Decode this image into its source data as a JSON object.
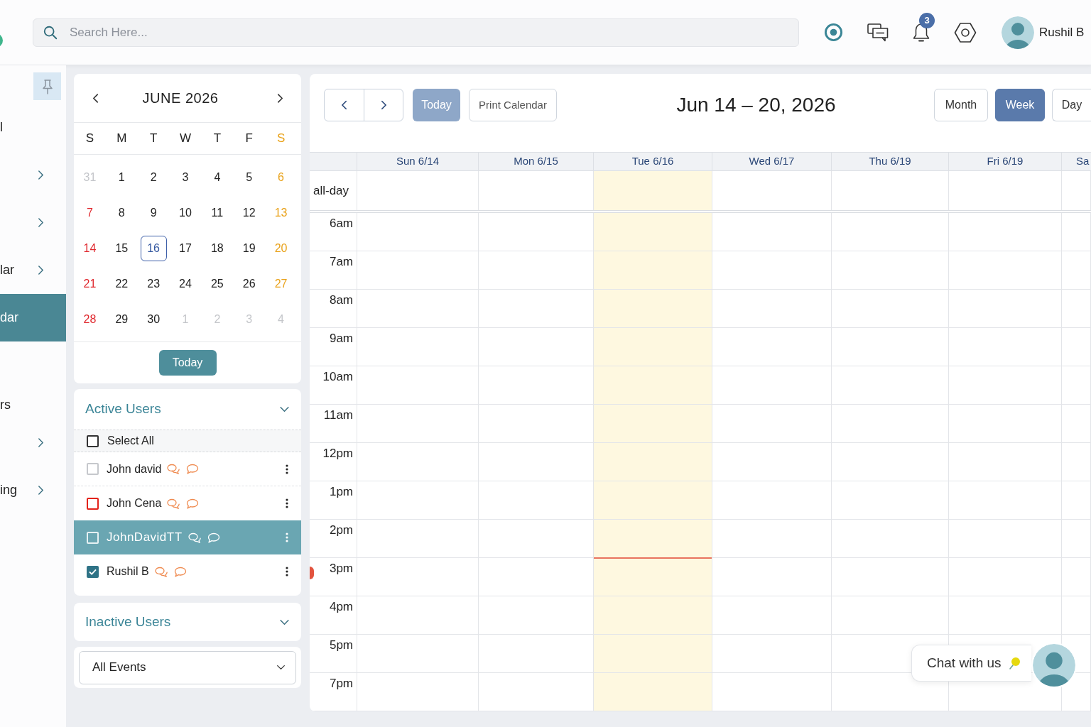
{
  "search": {
    "placeholder": "Search Here..."
  },
  "top_bar": {
    "notification_count": "3",
    "user_name": "Rushil B"
  },
  "sidebar": {
    "items": [
      {
        "kind": "link",
        "label": "l",
        "expandable": false,
        "selected": false
      },
      {
        "kind": "link",
        "expandable": true,
        "selected": false
      },
      {
        "kind": "link",
        "expandable": true,
        "selected": false
      },
      {
        "kind": "link",
        "label": "lar",
        "expandable": true,
        "selected": false
      },
      {
        "kind": "link",
        "label": "dar",
        "expandable": false,
        "selected": true
      },
      {
        "kind": "heading",
        "label": "rs"
      },
      {
        "kind": "link",
        "expandable": true,
        "selected": false
      },
      {
        "kind": "link",
        "label": "ing",
        "expandable": true,
        "selected": false
      }
    ]
  },
  "mini_calendar": {
    "title": "JUNE 2026",
    "weekdays": [
      "S",
      "M",
      "T",
      "W",
      "T",
      "F",
      "S"
    ],
    "weeks": [
      [
        {
          "day": "31",
          "muted": true,
          "selected": false
        },
        {
          "day": "1",
          "muted": false,
          "selected": false
        },
        {
          "day": "2",
          "muted": false,
          "selected": false
        },
        {
          "day": "3",
          "muted": false,
          "selected": false
        },
        {
          "day": "4",
          "muted": false,
          "selected": false
        },
        {
          "day": "5",
          "muted": false,
          "selected": false
        },
        {
          "day": "6",
          "muted": false,
          "selected": false
        }
      ],
      [
        {
          "day": "7",
          "muted": false,
          "selected": false
        },
        {
          "day": "8",
          "muted": false,
          "selected": false
        },
        {
          "day": "9",
          "muted": false,
          "selected": false
        },
        {
          "day": "10",
          "muted": false,
          "selected": false
        },
        {
          "day": "11",
          "muted": false,
          "selected": false
        },
        {
          "day": "12",
          "muted": false,
          "selected": false
        },
        {
          "day": "13",
          "muted": false,
          "selected": false
        }
      ],
      [
        {
          "day": "14",
          "muted": false,
          "selected": false
        },
        {
          "day": "15",
          "muted": false,
          "selected": false
        },
        {
          "day": "16",
          "muted": false,
          "selected": true
        },
        {
          "day": "17",
          "muted": false,
          "selected": false
        },
        {
          "day": "18",
          "muted": false,
          "selected": false
        },
        {
          "day": "19",
          "muted": false,
          "selected": false
        },
        {
          "day": "20",
          "muted": false,
          "selected": false
        }
      ],
      [
        {
          "day": "21",
          "muted": false,
          "selected": false
        },
        {
          "day": "22",
          "muted": false,
          "selected": false
        },
        {
          "day": "23",
          "muted": false,
          "selected": false
        },
        {
          "day": "24",
          "muted": false,
          "selected": false
        },
        {
          "day": "25",
          "muted": false,
          "selected": false
        },
        {
          "day": "26",
          "muted": false,
          "selected": false
        },
        {
          "day": "27",
          "muted": false,
          "selected": false
        }
      ],
      [
        {
          "day": "28",
          "muted": false,
          "selected": false
        },
        {
          "day": "29",
          "muted": false,
          "selected": false
        },
        {
          "day": "30",
          "muted": false,
          "selected": false
        },
        {
          "day": "1",
          "muted": true,
          "selected": false
        },
        {
          "day": "2",
          "muted": true,
          "selected": false
        },
        {
          "day": "3",
          "muted": true,
          "selected": false
        },
        {
          "day": "4",
          "muted": true,
          "selected": false
        }
      ]
    ],
    "today_button": "Today"
  },
  "active_users": {
    "title": "Active Users",
    "select_all": {
      "label": "Select All",
      "checked": false
    },
    "users": [
      {
        "name": "John david",
        "checked": false,
        "selected": false,
        "color": "#c6c8cc"
      },
      {
        "name": "John Cena",
        "checked": false,
        "selected": false,
        "color": "#e3231b"
      },
      {
        "name": "JohnDavidTT",
        "checked": false,
        "selected": true,
        "color": "#e6f1f3"
      },
      {
        "name": "Rushil B",
        "checked": true,
        "selected": false,
        "color": "#2f7386"
      }
    ]
  },
  "inactive_users": {
    "title": "Inactive Users"
  },
  "event_filter": {
    "value": "All Events"
  },
  "calendar": {
    "today_button": {
      "label": "Today",
      "disabled": true
    },
    "print_button": "Print Calendar",
    "title": "Jun 14 – 20, 2026",
    "views": [
      {
        "label": "Month",
        "selected": false
      },
      {
        "label": "Week",
        "selected": true
      },
      {
        "label": "Day",
        "selected": false
      }
    ],
    "days": [
      {
        "label": "Sun 6/14",
        "today": false
      },
      {
        "label": "Mon 6/15",
        "today": false
      },
      {
        "label": "Tue 6/16",
        "today": true
      },
      {
        "label": "Wed 6/17",
        "today": false
      },
      {
        "label": "Thu 6/19",
        "today": false
      },
      {
        "label": "Fri 6/19",
        "today": false
      },
      {
        "label": "Sa",
        "today": false
      }
    ],
    "all_day_label": "all-day",
    "hours": [
      {
        "label": "6am",
        "now": false
      },
      {
        "label": "7am",
        "now": false
      },
      {
        "label": "8am",
        "now": false
      },
      {
        "label": "9am",
        "now": false
      },
      {
        "label": "10am",
        "now": false
      },
      {
        "label": "11am",
        "now": false
      },
      {
        "label": "12pm",
        "now": false
      },
      {
        "label": "1pm",
        "now": false
      },
      {
        "label": "2pm",
        "now": false
      },
      {
        "label": "3pm",
        "now": true
      },
      {
        "label": "4pm",
        "now": false
      },
      {
        "label": "5pm",
        "now": false
      },
      {
        "label": "7pm",
        "now": false
      }
    ]
  },
  "chat": {
    "label": "Chat with us"
  }
}
